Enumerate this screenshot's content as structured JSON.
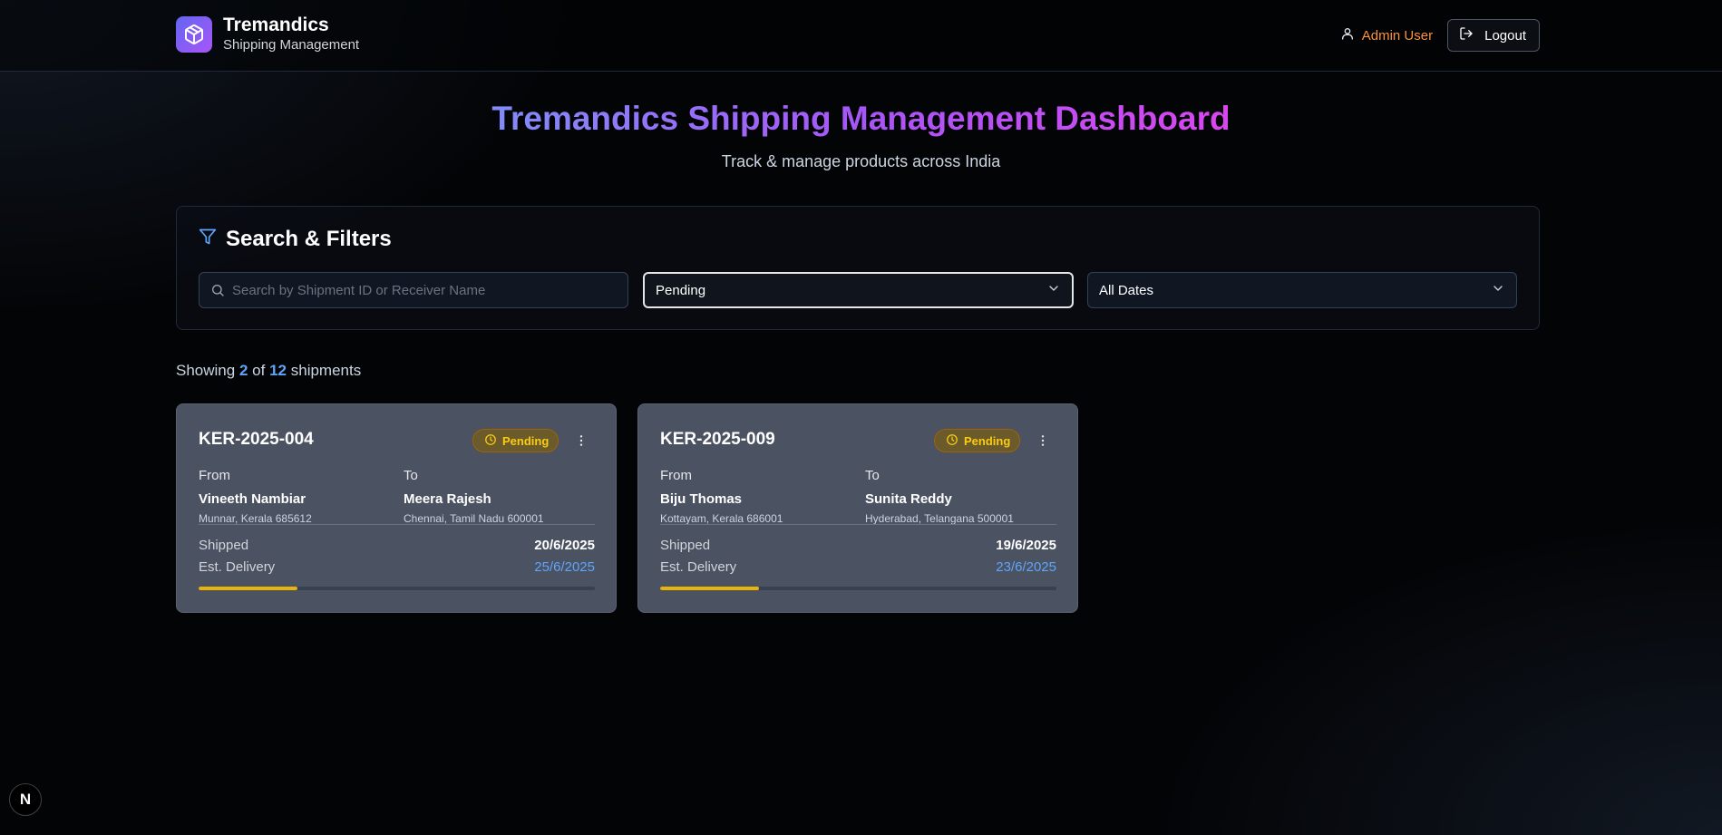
{
  "header": {
    "brand_name": "Tremandics",
    "brand_subtitle": "Shipping Management",
    "logo_icon": "package-icon",
    "user_icon": "user-icon",
    "user_name": "Admin User",
    "logout_icon": "logout-icon",
    "logout_label": "Logout"
  },
  "hero": {
    "title": "Tremandics Shipping Management Dashboard",
    "subtitle": "Track & manage products across India"
  },
  "filters": {
    "icon": "filter-icon",
    "title": "Search & Filters",
    "search_placeholder": "Search by Shipment ID or Receiver Name",
    "search_value": "",
    "status_selected": "Pending",
    "date_selected": "All Dates"
  },
  "results": {
    "prefix": "Showing",
    "shown": "2",
    "of_word": "of",
    "total": "12",
    "suffix": "shipments"
  },
  "shipments": [
    {
      "id": "KER-2025-004",
      "status": "Pending",
      "from_label": "From",
      "from_name": "Vineeth Nambiar",
      "from_address": "Munnar, Kerala 685612",
      "to_label": "To",
      "to_name": "Meera Rajesh",
      "to_address": "Chennai, Tamil Nadu 600001",
      "shipped_label": "Shipped",
      "shipped_date": "20/6/2025",
      "delivery_label": "Est. Delivery",
      "delivery_date": "25/6/2025",
      "progress": 0.25
    },
    {
      "id": "KER-2025-009",
      "status": "Pending",
      "from_label": "From",
      "from_name": "Biju Thomas",
      "from_address": "Kottayam, Kerala 686001",
      "to_label": "To",
      "to_name": "Sunita Reddy",
      "to_address": "Hyderabad, Telangana 500001",
      "shipped_label": "Shipped",
      "shipped_date": "19/6/2025",
      "delivery_label": "Est. Delivery",
      "delivery_date": "23/6/2025",
      "progress": 0.25
    }
  ],
  "dev_badge": {
    "label": "N"
  },
  "colors": {
    "accent_blue": "#60a5fa",
    "pending_yellow": "#facc15",
    "user_orange": "#fb923c",
    "title_gradient_start": "#818cf8",
    "title_gradient_end": "#d946ef"
  }
}
